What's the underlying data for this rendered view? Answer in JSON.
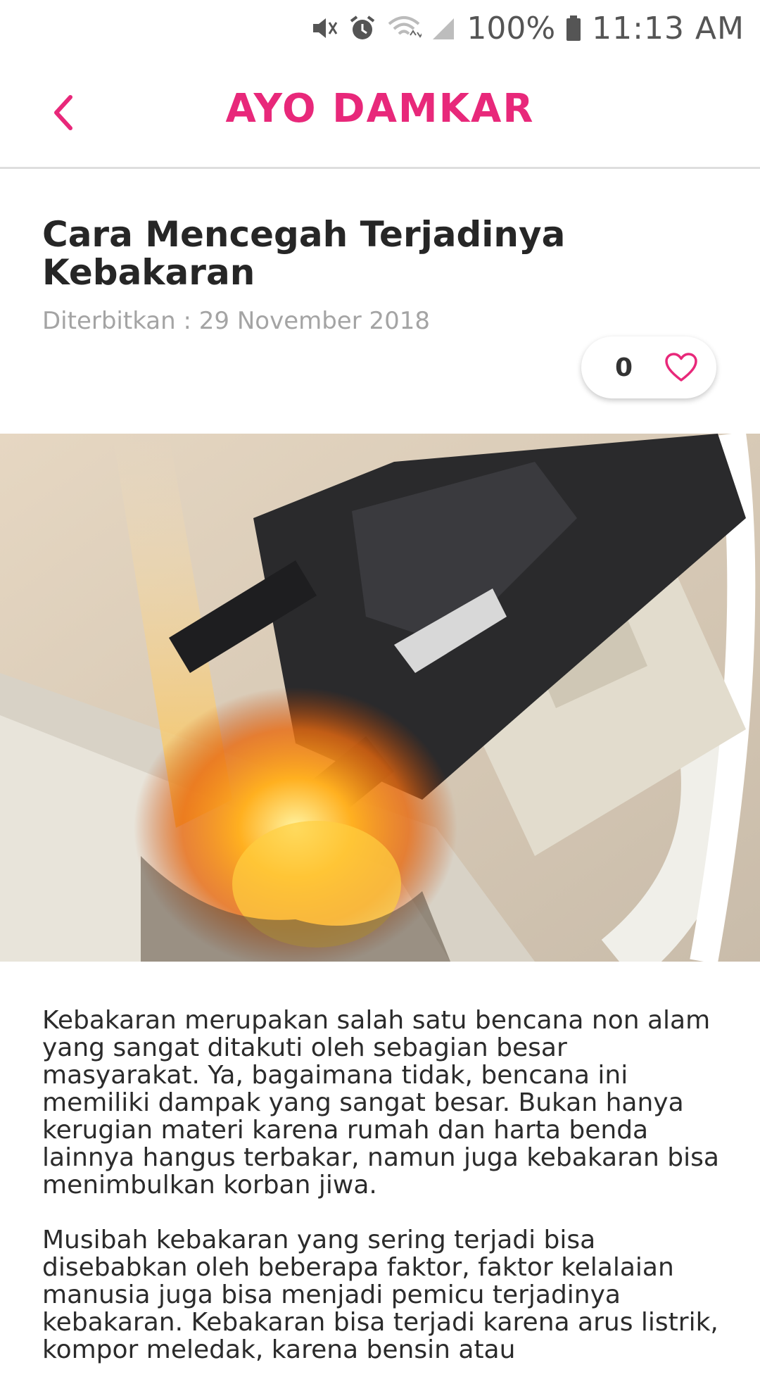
{
  "status_bar": {
    "battery": "100%",
    "time": "11:13 AM",
    "icons": [
      "mute-icon",
      "alarm-icon",
      "wifi-icon",
      "signal-icon",
      "battery-icon"
    ]
  },
  "header": {
    "title": "AYO DAMKAR",
    "back_icon": "chevron-left-icon",
    "accent_color": "#e8287a"
  },
  "article": {
    "title": "Cara Mencegah Terjadinya Kebakaran",
    "published": "Diterbitkan : 29 November 2018",
    "likes": "0",
    "like_icon": "heart-icon",
    "hero_icon": "burning-plug-image",
    "paragraphs": [
      "Kebakaran merupakan salah satu bencana non alam yang sangat ditakuti oleh sebagian besar masyarakat. Ya, bagaimana tidak, bencana ini memiliki dampak yang sangat besar. Bukan hanya kerugian materi karena rumah dan harta benda lainnya hangus terbakar, namun juga kebakaran bisa menimbulkan korban jiwa.",
      "Musibah kebakaran yang sering terjadi bisa disebabkan oleh beberapa faktor, faktor kelalaian manusia juga bisa menjadi pemicu terjadinya kebakaran. Kebakaran bisa terjadi karena arus listrik, kompor meledak, karena bensin atau"
    ]
  }
}
